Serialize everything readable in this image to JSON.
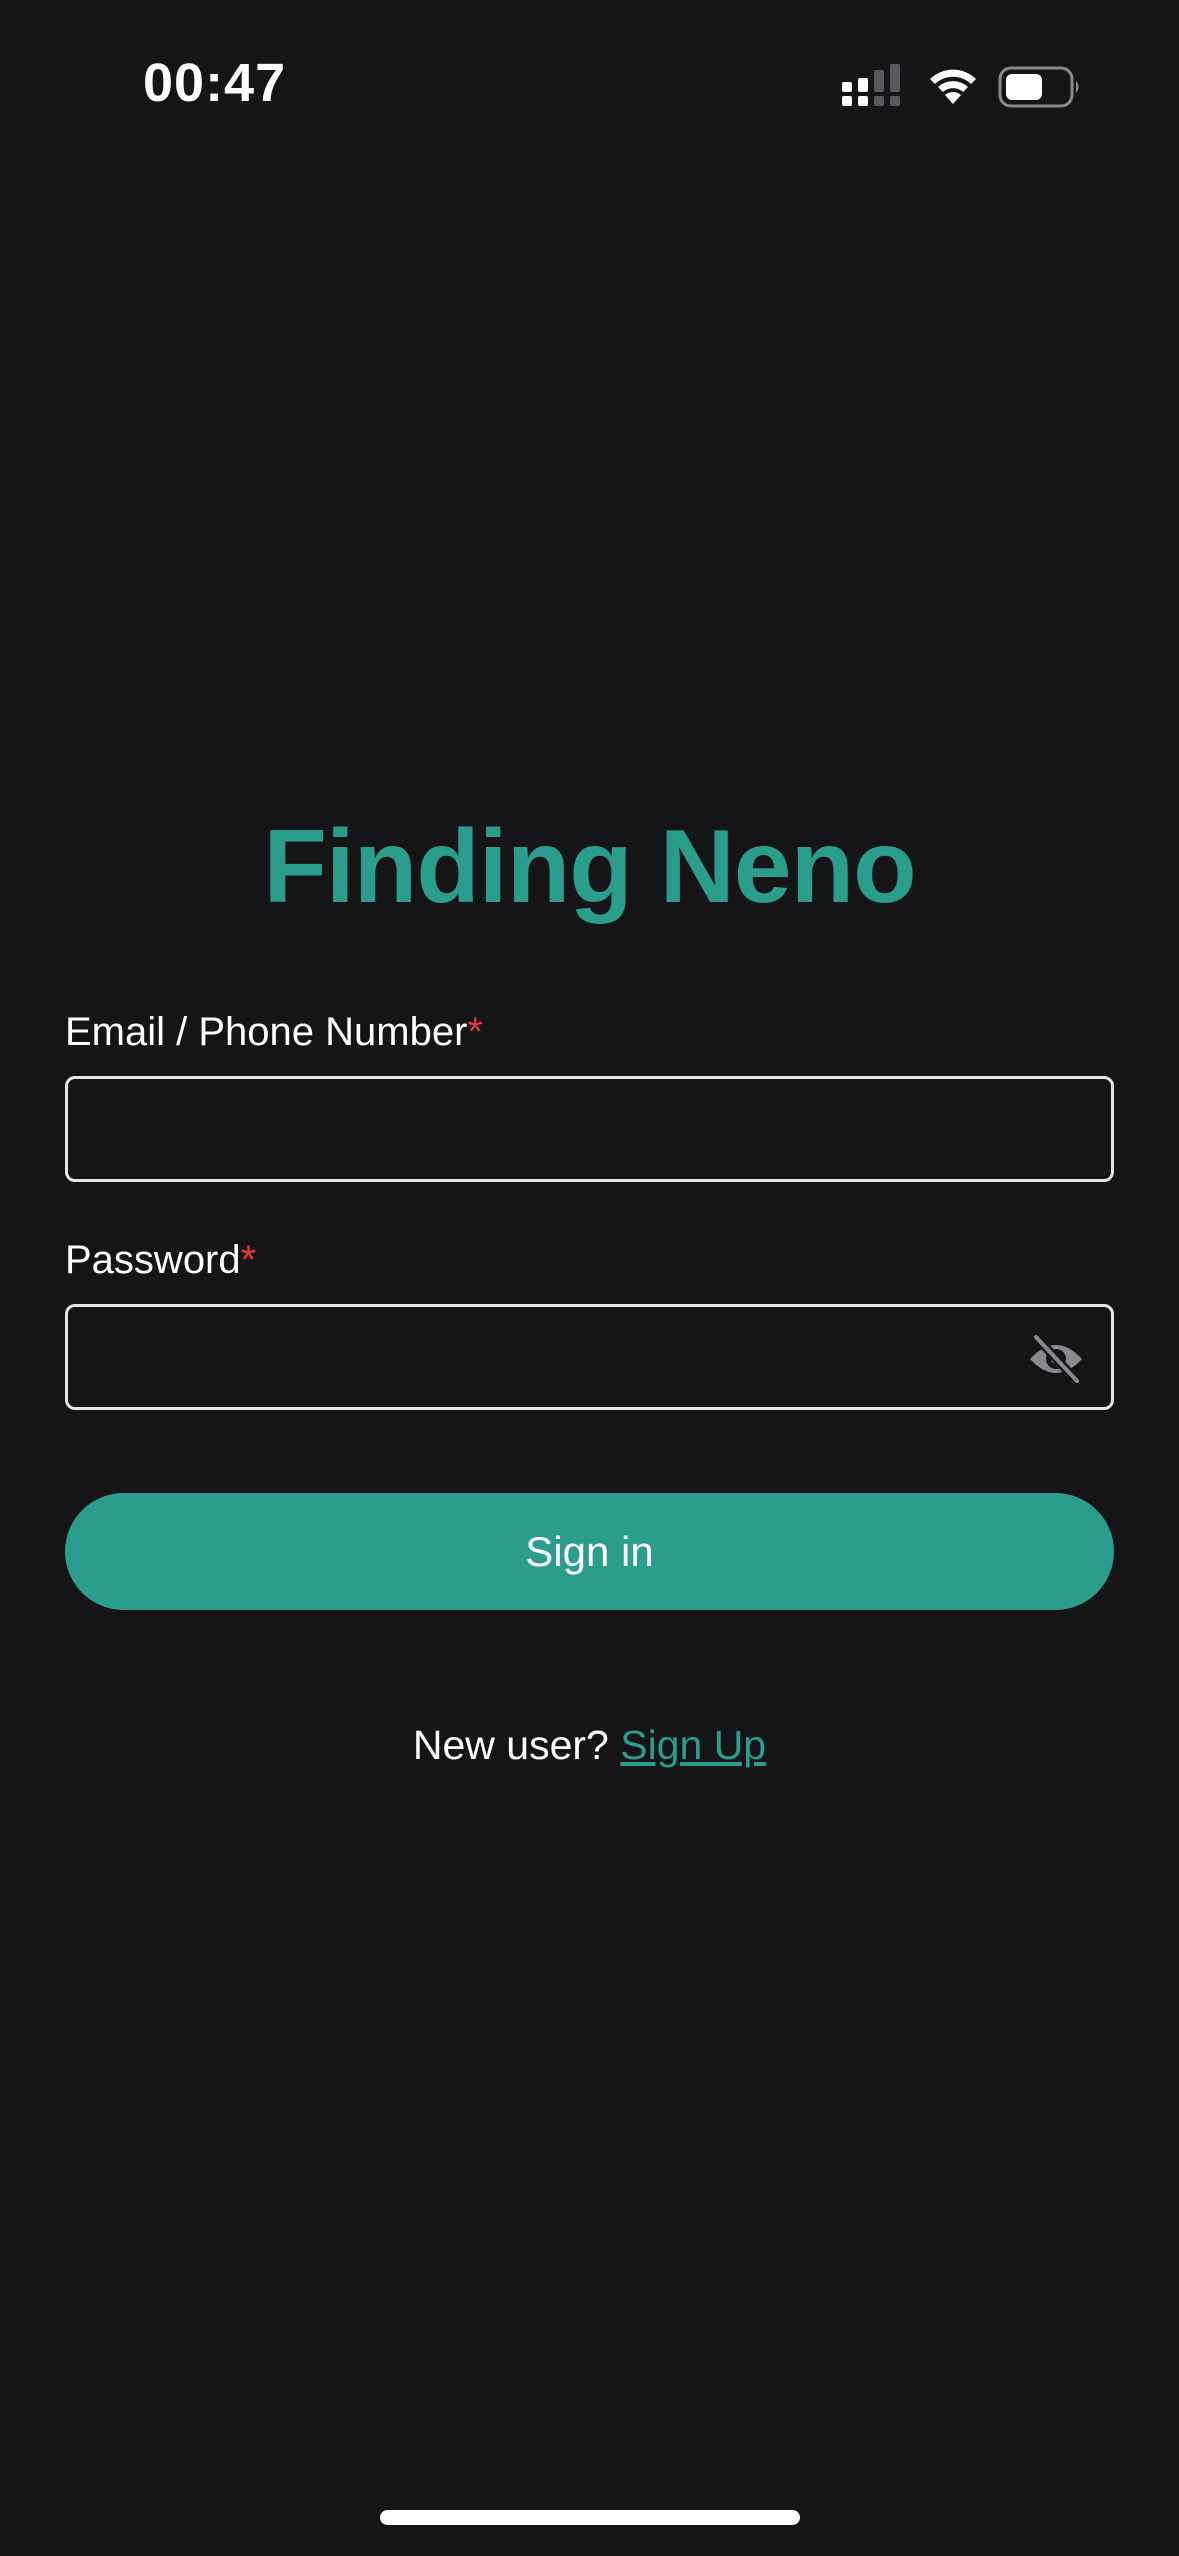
{
  "status_bar": {
    "time": "00:47",
    "icons": [
      "signal-icon",
      "wifi-icon",
      "battery-icon"
    ]
  },
  "app": {
    "title": "Finding Neno",
    "accent_color": "#2a9d8c",
    "background_color": "#151517",
    "required_color": "#e53935"
  },
  "form": {
    "email": {
      "label": "Email / Phone Number",
      "required_mark": "*",
      "value": "",
      "placeholder": ""
    },
    "password": {
      "label": "Password",
      "required_mark": "*",
      "value": "",
      "placeholder": "",
      "toggle_icon": "eye-off-icon"
    },
    "submit_label": "Sign in"
  },
  "footer": {
    "prompt": "New user?",
    "link_label": "Sign Up"
  }
}
